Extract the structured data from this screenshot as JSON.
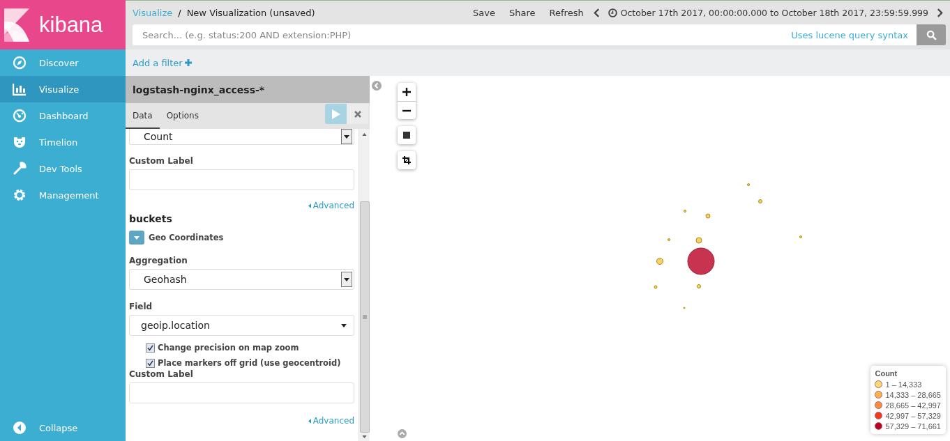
{
  "logo": {
    "text": "kibana"
  },
  "nav": [
    {
      "label": "Discover",
      "kind": "compass",
      "selected": false
    },
    {
      "label": "Visualize",
      "kind": "chart",
      "selected": true
    },
    {
      "label": "Dashboard",
      "kind": "dashboard",
      "selected": false
    },
    {
      "label": "Timelion",
      "kind": "bear",
      "selected": false
    },
    {
      "label": "Dev Tools",
      "kind": "wrench",
      "selected": false
    },
    {
      "label": "Management",
      "kind": "gear",
      "selected": false
    }
  ],
  "collapse": "Collapse",
  "breadcrumb": {
    "parent": "Visualize",
    "separator": "/",
    "current": "New Visualization (unsaved)"
  },
  "top_menu": [
    "Save",
    "Share",
    "Refresh"
  ],
  "time_range": "October 17th 2017, 00:00:00.000 to October 18th 2017, 23:59:59.999",
  "search": {
    "placeholder": "Search... (e.g. status:200 AND extension:PHP)",
    "hint": "Uses lucene query syntax"
  },
  "add_filter": "Add a filter",
  "editor": {
    "index_pattern": "logstash-nginx_access-*",
    "tabs": [
      {
        "label": "Data",
        "selected": true
      },
      {
        "label": "Options",
        "selected": false
      }
    ],
    "metric_select": "Count",
    "custom_label_1": "Custom Label",
    "advanced_1": "Advanced",
    "buckets_title": "buckets",
    "bucket_name": "Geo Coordinates",
    "aggregation_label": "Aggregation",
    "aggregation_value": "Geohash",
    "field_label": "Field",
    "field_value": "geoip.location",
    "options": [
      {
        "label": "Change precision on map zoom",
        "checked": true
      },
      {
        "label": "Place markers off grid (use geocentroid)",
        "checked": true
      }
    ],
    "custom_label_2": "Custom Label",
    "advanced_2": "Advanced"
  },
  "legend": {
    "title": "Count",
    "items": [
      {
        "label": "1 – 14,333",
        "color": "#fed976"
      },
      {
        "label": "14,333 – 28,665",
        "color": "#feb24c"
      },
      {
        "label": "28,665 – 42,997",
        "color": "#fd8d3c"
      },
      {
        "label": "42,997 – 57,329",
        "color": "#f03b20"
      },
      {
        "label": "57,329 – 71,661",
        "color": "#bd0026"
      }
    ]
  }
}
